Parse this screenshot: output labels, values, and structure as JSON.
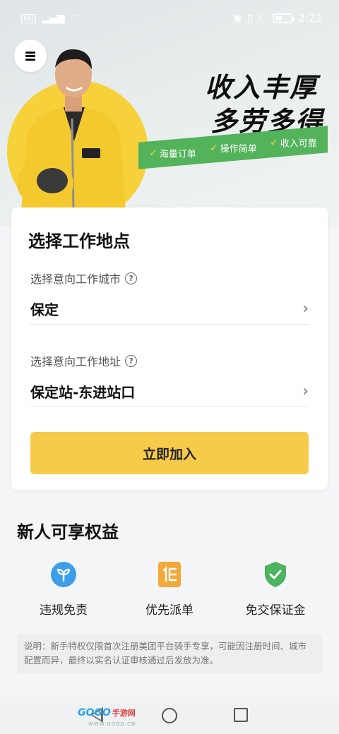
{
  "status_bar": {
    "left_text": "HD",
    "time": "2:22"
  },
  "hero": {
    "slogan_line1": "收入丰厚",
    "slogan_line2": "多劳多得",
    "features": [
      "海量订单",
      "操作简单",
      "收入可靠"
    ]
  },
  "card": {
    "title": "选择工作地点",
    "city_label": "选择意向工作城市",
    "city_value": "保定",
    "address_label": "选择意向工作地址",
    "address_value": "保定站-东进站口",
    "join_label": "立即加入"
  },
  "benefits": {
    "title": "新人可享权益",
    "items": [
      {
        "label": "违规免责",
        "icon": "sprout-icon",
        "color": "#3d9ee8"
      },
      {
        "label": "优先派单",
        "icon": "priority-list-icon",
        "color": "#f2a93b"
      },
      {
        "label": "免交保证金",
        "icon": "shield-check-icon",
        "color": "#4cb35e"
      }
    ]
  },
  "note": "说明：新手特权仅限首次注册美团平台骑手专享，可能因注册时间、城市配置而异，最终以实名认证审核通过后发放为准。",
  "watermark": {
    "brand": "GOGO",
    "brand_cn": "手游网",
    "url": "WWW.GOGO.CN"
  },
  "colors": {
    "accent_yellow": "#f6cb4a",
    "ribbon_green": "#52b35a"
  }
}
